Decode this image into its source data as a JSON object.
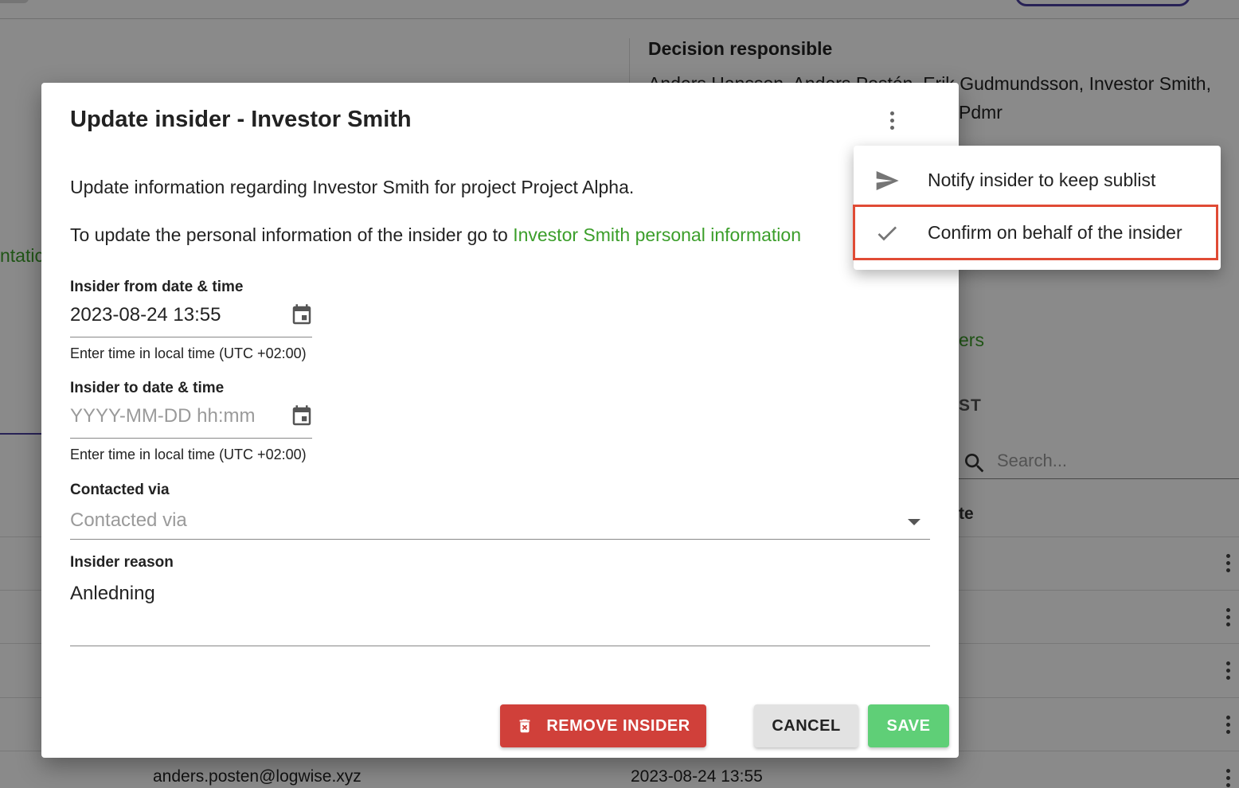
{
  "background": {
    "decision_label": "Decision responsible",
    "decision_names": "Anders Hansson, Anders Postén, Erik Gudmundsson, Investor Smith,",
    "decision_names_2": "Pdmr",
    "green_left": "ntatic",
    "green_right": "ers",
    "section_tail": "ST",
    "search_placeholder": "Search...",
    "column_tail": "te",
    "row_email": "anders.posten@logwise.xyz",
    "row_date": "2023-08-24 13:55"
  },
  "dialog": {
    "title": "Update insider - Investor Smith",
    "intro": "Update information regarding Investor Smith for project Project Alpha.",
    "personal_prefix": "To update the personal information of the insider go to ",
    "personal_link": "Investor Smith personal information",
    "from_label": "Insider from date & time",
    "from_value": "2023-08-24 13:55",
    "from_helper": "Enter time in local time (UTC +02:00)",
    "to_label": "Insider to date & time",
    "to_placeholder": "YYYY-MM-DD hh:mm",
    "to_helper": "Enter time in local time (UTC +02:00)",
    "contacted_label": "Contacted via",
    "contacted_placeholder": "Contacted via",
    "reason_label": "Insider reason",
    "reason_value": "Anledning",
    "remove_button": "REMOVE INSIDER",
    "cancel_button": "CANCEL",
    "save_button": "SAVE"
  },
  "menu": {
    "items": [
      {
        "label": "Notify insider to keep sublist",
        "icon": "send-icon"
      },
      {
        "label": "Confirm on behalf of the insider",
        "icon": "check-icon"
      }
    ]
  },
  "colors": {
    "link": "#3b9e2a",
    "remove": "#d0403a",
    "save": "#5fcf77",
    "highlight": "#e04b35"
  }
}
